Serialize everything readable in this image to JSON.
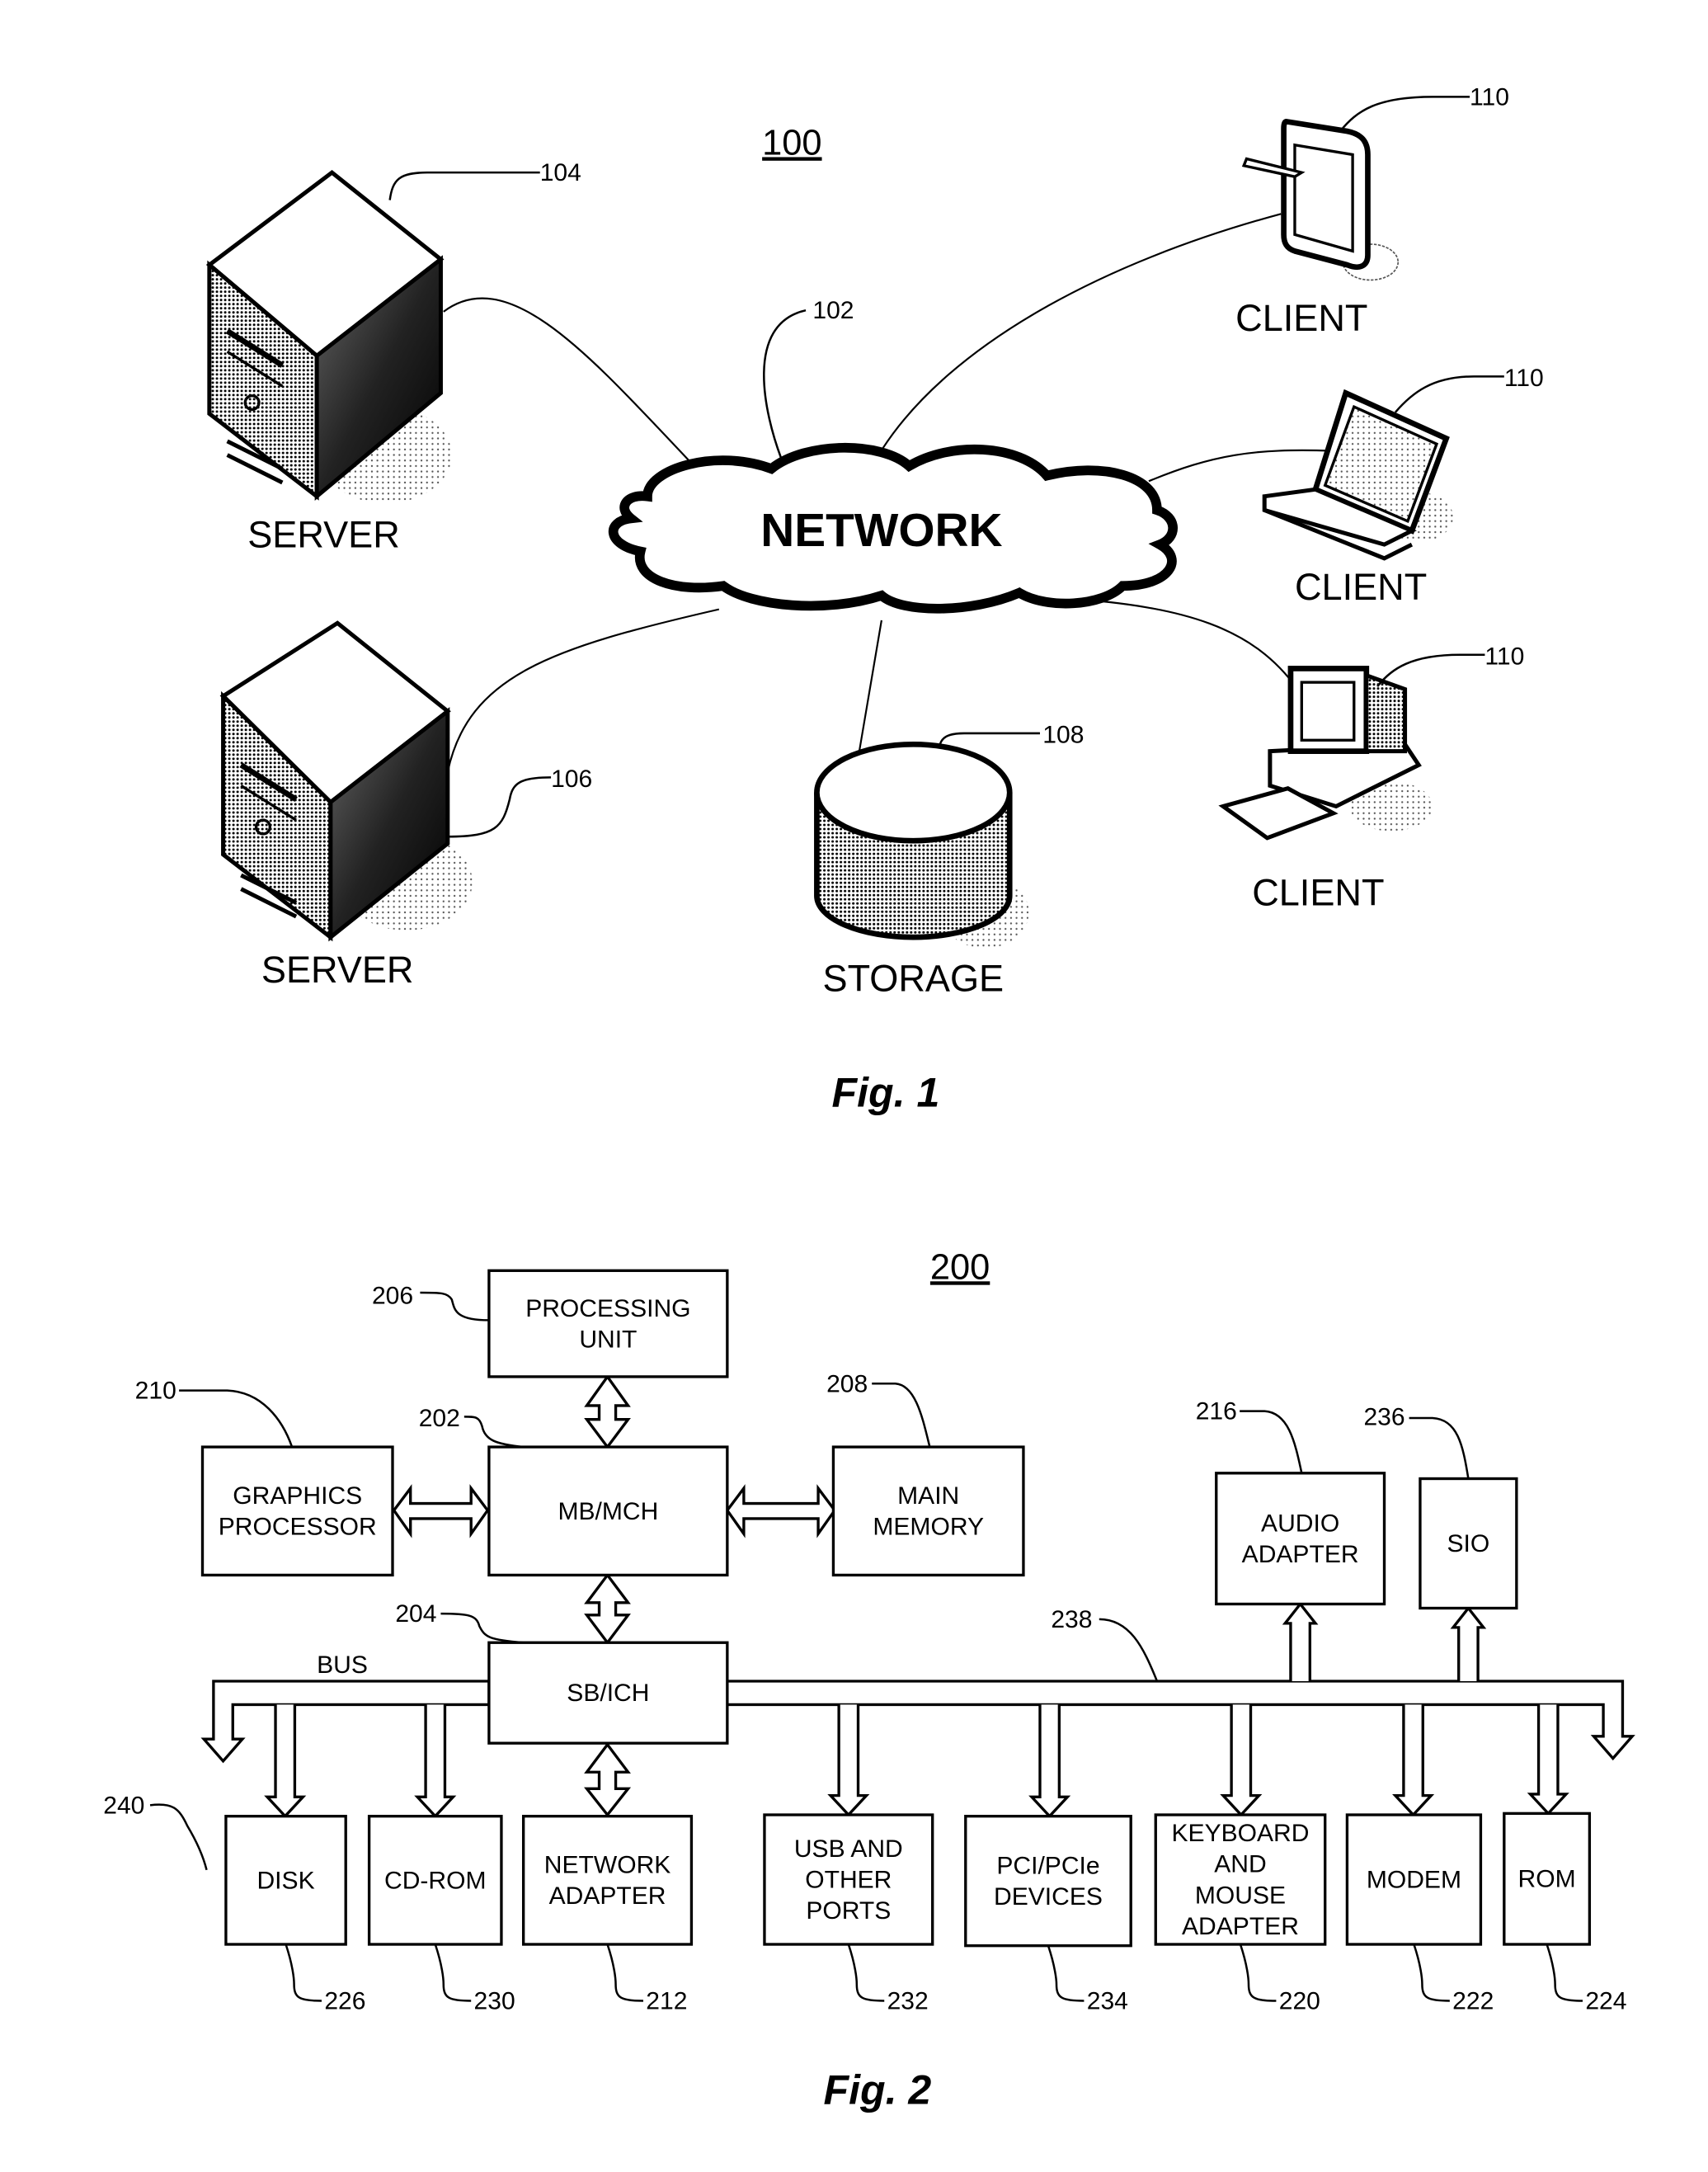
{
  "fig1": {
    "title_ref": "100",
    "caption": "Fig. 1",
    "network": {
      "label": "NETWORK",
      "ref": "102"
    },
    "servers": [
      {
        "label": "SERVER",
        "ref": "104"
      },
      {
        "label": "SERVER",
        "ref": "106"
      }
    ],
    "storage": {
      "label": "STORAGE",
      "ref": "108"
    },
    "clients": [
      {
        "label": "CLIENT",
        "ref": "110",
        "device": "tablet"
      },
      {
        "label": "CLIENT",
        "ref": "110",
        "device": "laptop"
      },
      {
        "label": "CLIENT",
        "ref": "110",
        "device": "desktop"
      }
    ]
  },
  "fig2": {
    "title_ref": "200",
    "caption": "Fig. 2",
    "bus_label": "BUS",
    "bus_ref": "238",
    "group_ref": "240",
    "blocks": {
      "processing_unit": {
        "lines": [
          "PROCESSING",
          "UNIT"
        ],
        "ref": "206"
      },
      "graphics_processor": {
        "lines": [
          "GRAPHICS",
          "PROCESSOR"
        ],
        "ref": "210"
      },
      "mb_mch": {
        "lines": [
          "MB/MCH"
        ],
        "ref": "202"
      },
      "main_memory": {
        "lines": [
          "MAIN",
          "MEMORY"
        ],
        "ref": "208"
      },
      "sb_ich": {
        "lines": [
          "SB/ICH"
        ],
        "ref": "204"
      },
      "audio_adapter": {
        "lines": [
          "AUDIO",
          "ADAPTER"
        ],
        "ref": "216"
      },
      "sio": {
        "lines": [
          "SIO"
        ],
        "ref": "236"
      },
      "disk": {
        "lines": [
          "DISK"
        ],
        "ref": "226"
      },
      "cd_rom": {
        "lines": [
          "CD-ROM"
        ],
        "ref": "230"
      },
      "network_adapter": {
        "lines": [
          "NETWORK",
          "ADAPTER"
        ],
        "ref": "212"
      },
      "usb_ports": {
        "lines": [
          "USB AND",
          "OTHER",
          "PORTS"
        ],
        "ref": "232"
      },
      "pci_devices": {
        "lines": [
          "PCI/PCIe",
          "DEVICES"
        ],
        "ref": "234"
      },
      "keyboard_mouse": {
        "lines": [
          "KEYBOARD",
          "AND",
          "MOUSE",
          "ADAPTER"
        ],
        "ref": "220"
      },
      "modem": {
        "lines": [
          "MODEM"
        ],
        "ref": "222"
      },
      "rom": {
        "lines": [
          "ROM"
        ],
        "ref": "224"
      }
    }
  }
}
